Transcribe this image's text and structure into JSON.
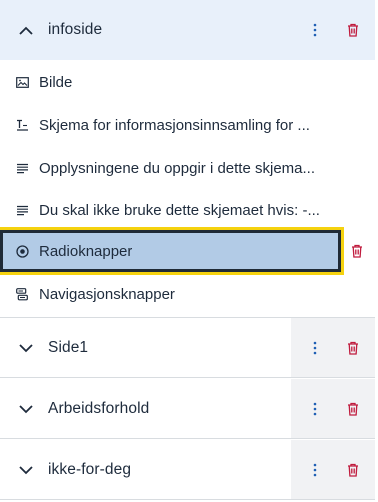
{
  "colors": {
    "accent_blue": "#1e5fb4",
    "delete_red": "#c01b3d",
    "selection_border": "#f5d20f",
    "selected_fill": "#b2cbe6",
    "active_header": "#e8f0fa"
  },
  "sections": [
    {
      "title": "infoside",
      "expanded": true,
      "chevron": "chevron-up-icon",
      "items": [
        {
          "label": "Bilde",
          "icon": "image-icon"
        },
        {
          "label": "Skjema for informasjonsinnsamling for ...",
          "icon": "heading-icon"
        },
        {
          "label": "Opplysningene du oppgir i dette skjema...",
          "icon": "paragraph-icon"
        },
        {
          "label": "Du skal ikke bruke dette skjemaet hvis: -...",
          "icon": "paragraph-icon"
        },
        {
          "label": "Radioknapper",
          "icon": "radio-icon",
          "selected": true
        },
        {
          "label": "Navigasjonsknapper",
          "icon": "navigation-buttons-icon"
        }
      ]
    },
    {
      "title": "Side1",
      "expanded": false,
      "chevron": "chevron-down-icon"
    },
    {
      "title": "Arbeidsforhold",
      "expanded": false,
      "chevron": "chevron-down-icon"
    },
    {
      "title": "ikke-for-deg",
      "expanded": false,
      "chevron": "chevron-down-icon"
    }
  ]
}
